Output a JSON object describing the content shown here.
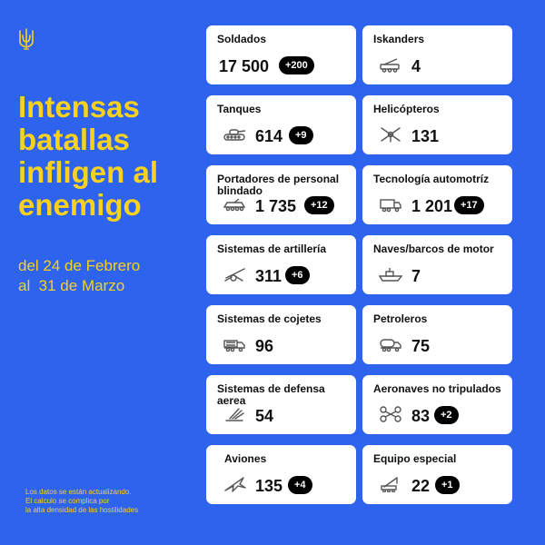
{
  "headline": "Intensas batallas infligen al enemigo",
  "period": {
    "line1": "del 24 de Febrero",
    "line2": "al  31 de Marzo"
  },
  "footnote": {
    "line1": "Los datos se están actualizando.",
    "line2": "El calculo se complica por",
    "line3": "la alta densidad de las hostilidades"
  },
  "stats": {
    "soldiers": {
      "label": "Soldados",
      "value": "17 500",
      "delta": "+200"
    },
    "iskanders": {
      "label": "Iskanders",
      "value": "4"
    },
    "tanks": {
      "label": "Tanques",
      "value": "614",
      "delta": "+9"
    },
    "helicopters": {
      "label": "Helicópteros",
      "value": "131"
    },
    "apc": {
      "label": "Portadores de personal blindado",
      "value": "1 735",
      "delta": "+12"
    },
    "vehicles": {
      "label": "Tecnología automotríz",
      "value": "1 201",
      "delta": "+17"
    },
    "artillery": {
      "label": "Sistemas de artillería",
      "value": "311",
      "delta": "+6"
    },
    "ships": {
      "label": "Naves/barcos de motor",
      "value": "7"
    },
    "mlrs": {
      "label": "Sistemas de cojetes",
      "value": "96"
    },
    "tankers": {
      "label": "Petroleros",
      "value": "75"
    },
    "air_defense": {
      "label": "Sistemas de defensa aerea",
      "value": "54"
    },
    "drones": {
      "label": "Aeronaves no tripulados",
      "value": "83",
      "delta": "+2"
    },
    "aircraft": {
      "label": "Aviones",
      "value": "135",
      "delta": "+4"
    },
    "special": {
      "label": "Equipo especial",
      "value": "22",
      "delta": "+1"
    }
  },
  "icons": {
    "emblem": "trident-icon",
    "iskanders": "missile-launcher-icon",
    "tanks": "tank-icon",
    "helicopters": "helicopter-icon",
    "apc": "armored-carrier-icon",
    "vehicles": "truck-icon",
    "artillery": "artillery-icon",
    "ships": "ship-icon",
    "mlrs": "rocket-truck-icon",
    "tankers": "fuel-tanker-icon",
    "air_defense": "air-defense-icon",
    "drones": "drone-icon",
    "aircraft": "fighter-jet-icon",
    "special": "crane-icon"
  },
  "colors": {
    "background": "#2E63EE",
    "accent": "#F8D21C",
    "card": "#FFFFFF",
    "badge": "#000000"
  }
}
